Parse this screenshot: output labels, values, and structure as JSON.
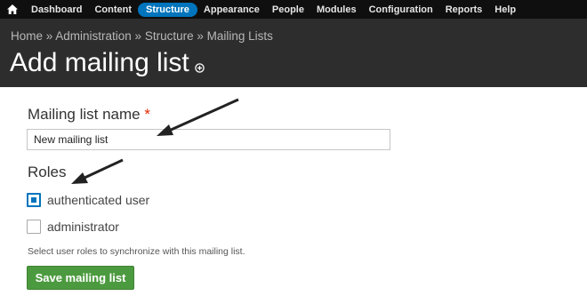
{
  "toolbar": {
    "home_icon": "home-icon",
    "items": [
      {
        "label": "Dashboard"
      },
      {
        "label": "Content"
      },
      {
        "label": "Structure",
        "active": true
      },
      {
        "label": "Appearance"
      },
      {
        "label": "People"
      },
      {
        "label": "Modules"
      },
      {
        "label": "Configuration"
      },
      {
        "label": "Reports"
      },
      {
        "label": "Help"
      }
    ],
    "active_color": "#0074bd"
  },
  "header": {
    "breadcrumb": "Home » Administration » Structure » Mailing Lists",
    "title": "Add mailing list",
    "shortcut_icon": "add-shortcut-icon"
  },
  "form": {
    "name_label": "Mailing list name",
    "required_mark": "*",
    "name_value": "New mailing list",
    "roles_label": "Roles",
    "roles": [
      {
        "label": "authenticated user",
        "checked": true
      },
      {
        "label": "administrator",
        "checked": false
      }
    ],
    "help_text": "Select user roles to synchronize with this mailing list.",
    "save_label": "Save mailing list",
    "save_color": "#4c9a3f"
  }
}
